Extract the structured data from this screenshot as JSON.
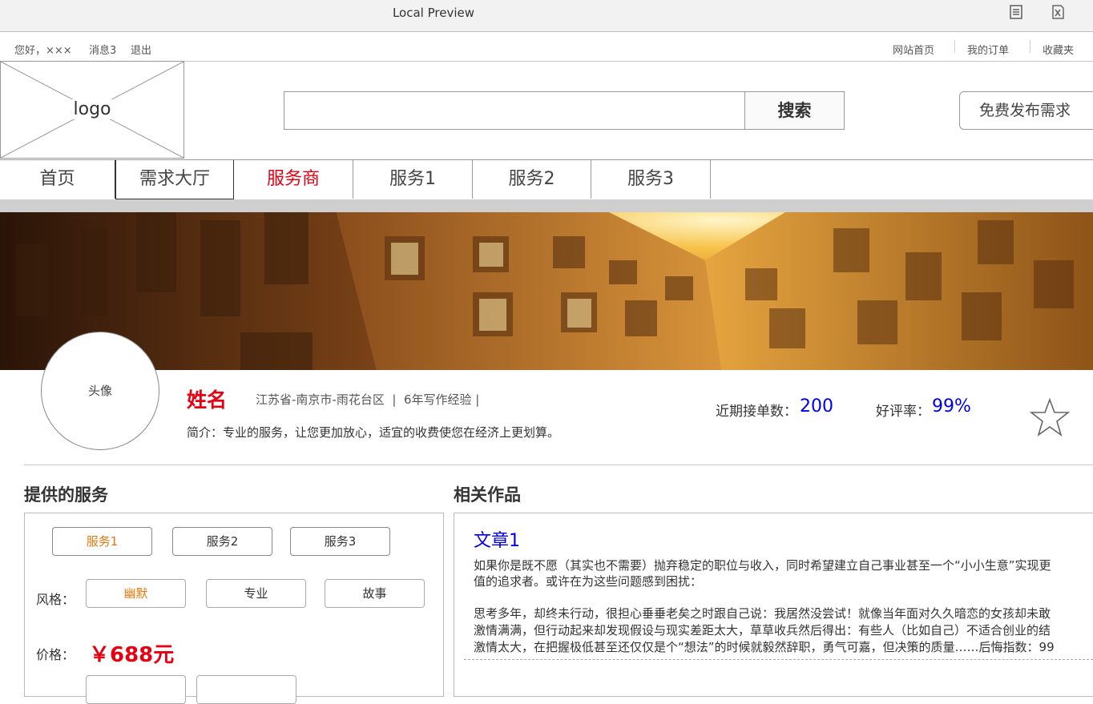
{
  "window": {
    "title": "Local Preview"
  },
  "topbar": {
    "greeting": "您好，×××",
    "messages": "消息3",
    "logout": "退出",
    "home_link": "网站首页",
    "orders_link": "我的订单",
    "favorites_link": "收藏夹"
  },
  "header": {
    "logo": "logo",
    "search_value": "",
    "search_button": "搜索",
    "publish_button": "免费发布需求"
  },
  "nav": {
    "items": [
      {
        "label": "首页"
      },
      {
        "label": "需求大厅"
      },
      {
        "label": "服务商",
        "active": true
      },
      {
        "label": "服务1"
      },
      {
        "label": "服务2"
      },
      {
        "label": "服务3"
      }
    ]
  },
  "profile": {
    "avatar": "头像",
    "name": "姓名",
    "location": "江苏省-南京市-雨花台区  |  6年写作经验 |",
    "intro": "简介：专业的服务，让您更加放心，适宜的收费使您在经济上更划算。",
    "orders_label": "近期接单数：",
    "orders_value": "200",
    "rating_label": "好评率：",
    "rating_value": "99%"
  },
  "services": {
    "title": "提供的服务",
    "service_options": [
      "服务1",
      "服务2",
      "服务3"
    ],
    "style_label": "风格：",
    "style_options": [
      "幽默",
      "专业",
      "故事"
    ],
    "price_label": "价格：",
    "price": "￥688元"
  },
  "works": {
    "title": "相关作品",
    "article_title": "文章1",
    "para1_line1": "如果你是既不愿（其实也不需要）抛弃稳定的职位与收入，同时希望建立自己事业甚至一个“小小生意”实现更",
    "para1_line2": "值的追求者。或许在为这些问题感到困扰：",
    "para2_line1": "思考多年，却终未行动，很担心垂垂老矣之时跟自己说：我居然没尝试！就像当年面对久久暗恋的女孩却未敢",
    "para2_line2": "激情满满，但行动起来却发现假设与现实差距太大，草草收兵然后得出：有些人（比如自己）不适合创业的结",
    "para2_line3": "激情太大，在把握极低甚至还仅仅是个“想法”的时候就毅然辞职，勇气可嘉，但决策的质量……后悔指数：99"
  },
  "colors": {
    "accent": "#e60012",
    "link": "#0000ee",
    "selected": "#e8770b"
  }
}
